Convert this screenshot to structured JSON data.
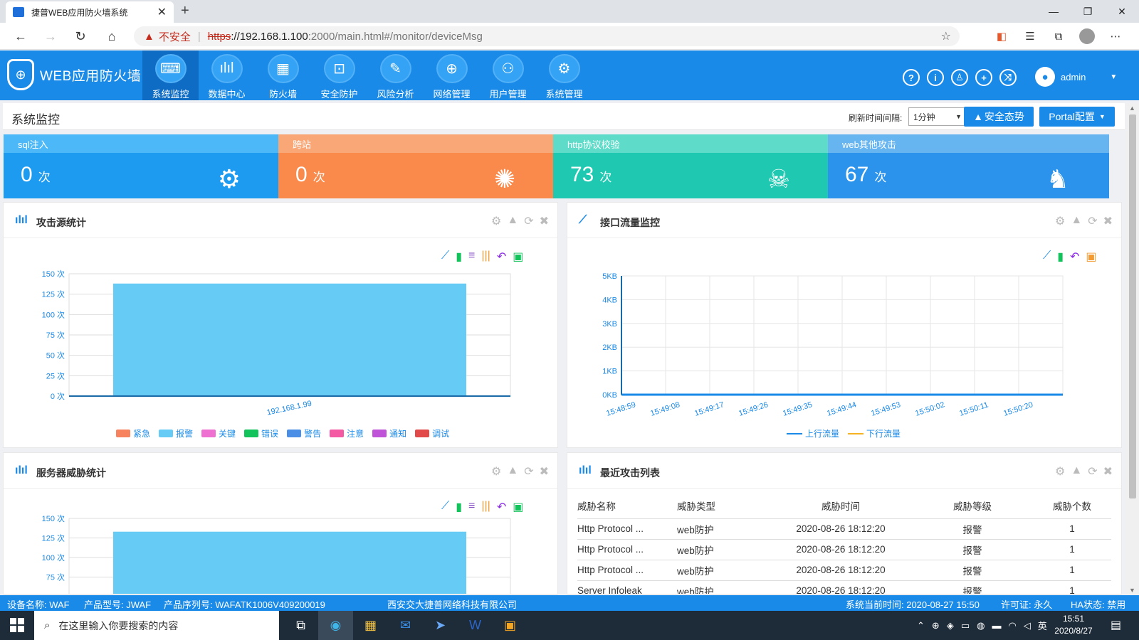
{
  "browser": {
    "tab_title": "捷普WEB应用防火墙系统",
    "tab_close": "✕",
    "new_tab": "+",
    "security_label": "不安全",
    "url_scheme": "https",
    "url_host": "://192.168.1.100",
    "url_rest": ":2000/main.html#/monitor/deviceMsg"
  },
  "app": {
    "name": "WEB应用防火墙",
    "nav": [
      {
        "label": "系统监控",
        "icon": "monitor-icon"
      },
      {
        "label": "数据中心",
        "icon": "data-chart-icon"
      },
      {
        "label": "防火墙",
        "icon": "firewall-icon"
      },
      {
        "label": "安全防护",
        "icon": "lock-icon"
      },
      {
        "label": "风险分析",
        "icon": "risk-analysis-icon"
      },
      {
        "label": "网络管理",
        "icon": "globe-icon"
      },
      {
        "label": "用户管理",
        "icon": "user-settings-icon"
      },
      {
        "label": "系统管理",
        "icon": "gear-icon"
      }
    ],
    "active_nav": 0,
    "user": "admin"
  },
  "page": {
    "title": "系统监控",
    "refresh_label": "刷新时间间隔:",
    "refresh_value": "1分钟",
    "security_btn": "安全态势",
    "portal_btn": "Portal配置"
  },
  "cards": [
    {
      "title": "sql注入",
      "value": "0",
      "unit": "次",
      "header_color": "#4db8f7",
      "body_color": "#1d9bf0",
      "icon": "gear-cog-icon"
    },
    {
      "title": "跨站",
      "value": "0",
      "unit": "次",
      "header_color": "#f9a777",
      "body_color": "#f98a4b",
      "icon": "virus-icon"
    },
    {
      "title": "http协议校验",
      "value": "73",
      "unit": "次",
      "header_color": "#5fdcc9",
      "body_color": "#1fc8b0",
      "icon": "skull-icon"
    },
    {
      "title": "web其他攻击",
      "value": "67",
      "unit": "次",
      "header_color": "#66b5f0",
      "body_color": "#2b93eb",
      "icon": "trojan-horse-icon"
    }
  ],
  "panels": {
    "attack_source": {
      "title": "攻击源统计"
    },
    "interface_traffic": {
      "title": "接口流量监控"
    },
    "server_threat": {
      "title": "服务器威胁统计"
    },
    "recent_attacks": {
      "title": "最近攻击列表"
    }
  },
  "chart_data": [
    {
      "type": "bar",
      "title": "攻击源统计",
      "categories": [
        "192.168.1.99"
      ],
      "values": [
        138
      ],
      "yticks": [
        "0 次",
        "25 次",
        "50 次",
        "75 次",
        "100 次",
        "125 次",
        "150 次"
      ],
      "ylim": [
        0,
        150
      ],
      "bar_color": "#66ccf5",
      "legend": [
        {
          "name": "紧急",
          "color": "#f7825e"
        },
        {
          "name": "报警",
          "color": "#66ccf5"
        },
        {
          "name": "关键",
          "color": "#ee70d0"
        },
        {
          "name": "错误",
          "color": "#12c25a"
        },
        {
          "name": "警告",
          "color": "#4b8ee6"
        },
        {
          "name": "注意",
          "color": "#f45aa4"
        },
        {
          "name": "通知",
          "color": "#c054d8"
        },
        {
          "name": "调试",
          "color": "#e24a4a"
        }
      ]
    },
    {
      "type": "line",
      "title": "接口流量监控",
      "x": [
        "15:48:59",
        "15:49:08",
        "15:49:17",
        "15:49:26",
        "15:49:35",
        "15:49:44",
        "15:49:53",
        "15:50:02",
        "15:50:11",
        "15:50:20"
      ],
      "yticks": [
        "0KB",
        "1KB",
        "2KB",
        "3KB",
        "4KB",
        "5KB"
      ],
      "ylim": [
        0,
        5
      ],
      "series": [
        {
          "name": "上行流量",
          "color": "#1a8ae8",
          "values": [
            0,
            0,
            0,
            0,
            0,
            0,
            0,
            0,
            0,
            0
          ]
        },
        {
          "name": "下行流量",
          "color": "#f5b324",
          "values": [
            0,
            0,
            0,
            0,
            0,
            0,
            0,
            0,
            0,
            0
          ]
        }
      ]
    },
    {
      "type": "bar",
      "title": "服务器威胁统计",
      "categories": [
        ""
      ],
      "values": [
        133
      ],
      "yticks": [
        "75 次",
        "100 次",
        "125 次",
        "150 次"
      ],
      "ylim": [
        0,
        150
      ],
      "bar_color": "#66ccf5"
    }
  ],
  "attack_table": {
    "headers": [
      "威胁名称",
      "威胁类型",
      "威胁时间",
      "威胁等级",
      "威胁个数"
    ],
    "rows": [
      [
        "Http Protocol ...",
        "web防护",
        "2020-08-26 18:12:20",
        "报警",
        "1"
      ],
      [
        "Http Protocol ...",
        "web防护",
        "2020-08-26 18:12:20",
        "报警",
        "1"
      ],
      [
        "Http Protocol ...",
        "web防护",
        "2020-08-26 18:12:20",
        "报警",
        "1"
      ],
      [
        "Server Infoleak",
        "web防护",
        "2020-08-26 18:12:20",
        "报警",
        "1"
      ]
    ]
  },
  "statusbar": {
    "device": "设备名称:  WAF",
    "model": "产品型号:  JWAF",
    "serial": "产品序列号:  WAFATK1006V409200019",
    "company": "西安交大捷普网络科技有限公司",
    "time": "系统当前时间:  2020-08-27 15:50",
    "license": "许可证:  永久",
    "ha": "HA状态:  禁用"
  },
  "taskbar": {
    "search_placeholder": "在这里输入你要搜索的内容",
    "time": "15:51",
    "date": "2020/8/27",
    "ime": "英"
  }
}
